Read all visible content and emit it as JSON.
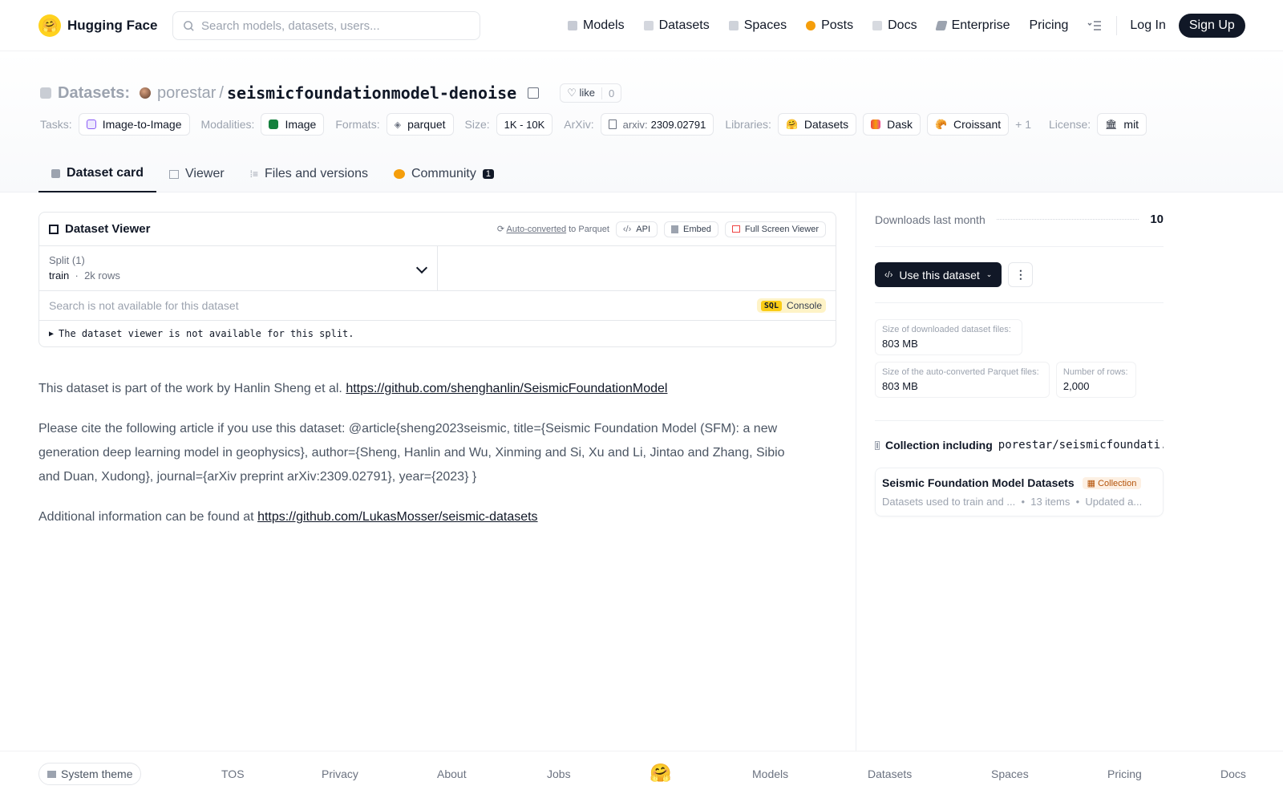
{
  "nav": {
    "brand": "Hugging Face",
    "search_placeholder": "Search models, datasets, users...",
    "links": [
      "Models",
      "Datasets",
      "Spaces",
      "Posts",
      "Docs",
      "Enterprise",
      "Pricing"
    ],
    "login": "Log In",
    "signup": "Sign Up"
  },
  "header": {
    "section": "Datasets:",
    "owner": "porestar",
    "slash": "/",
    "repo": "seismicfoundationmodel-denoise",
    "like_label": "like",
    "like_count": "0",
    "tasks_label": "Tasks:",
    "task": "Image-to-Image",
    "modalities_label": "Modalities:",
    "modality": "Image",
    "formats_label": "Formats:",
    "format": "parquet",
    "size_label": "Size:",
    "size": "1K - 10K",
    "arxiv_label": "ArXiv:",
    "arxiv_prefix": "arxiv:",
    "arxiv_id": "2309.02791",
    "libraries_label": "Libraries:",
    "libraries": [
      "Datasets",
      "Dask",
      "Croissant"
    ],
    "libraries_more": "+ 1",
    "license_label": "License:",
    "license": "mit"
  },
  "tabs": {
    "card": "Dataset card",
    "viewer": "Viewer",
    "files": "Files and versions",
    "community": "Community",
    "community_count": "1"
  },
  "viewer": {
    "title": "Dataset Viewer",
    "auto_converted": "Auto-converted",
    "to_parquet": "to Parquet",
    "api": "API",
    "embed": "Embed",
    "fullscreen": "Full Screen Viewer",
    "split_label": "Split (1)",
    "split_name": "train",
    "split_rows": "2k rows",
    "search_placeholder": "Search is not available for this dataset",
    "sql": "SQL",
    "console": "Console",
    "unavailable": "The dataset viewer is not available for this split."
  },
  "card": {
    "p1_text": "This dataset is part of the work by Hanlin Sheng et al. ",
    "p1_link": "https://github.com/shenghanlin/SeismicFoundationModel",
    "p2_text": "Please cite the following article if you use this dataset: @article{sheng2023seismic, title={Seismic Foundation Model (SFM): a new generation deep learning model in geophysics}, author={Sheng, Hanlin and Wu, Xinming and Si, Xu and Li, Jintao and Zhang, Sibio and Duan, Xudong}, journal={arXiv preprint arXiv:2309.02791}, year={2023} }",
    "p3_text": "Additional information can be found at ",
    "p3_link": "https://github.com/LukasMosser/seismic-datasets"
  },
  "sidebar": {
    "downloads_label": "Downloads last month",
    "downloads_value": "10",
    "use_dataset": "Use this dataset",
    "size_dl_label": "Size of downloaded dataset files:",
    "size_dl_value": "803 MB",
    "size_parquet_label": "Size of the auto-converted Parquet files:",
    "size_parquet_value": "803 MB",
    "rows_label": "Number of rows:",
    "rows_value": "2,000",
    "collection_label": "Collection including",
    "collection_repo": "porestar/seismicfoundati...",
    "collection_title": "Seismic Foundation Model Datasets",
    "collection_badge": "Collection",
    "collection_desc": "Datasets used to train and ...",
    "collection_items": "13 items",
    "collection_updated": "Updated a..."
  },
  "footer": {
    "theme": "System theme",
    "links": [
      "TOS",
      "Privacy",
      "About",
      "Jobs",
      "Models",
      "Datasets",
      "Spaces",
      "Pricing",
      "Docs"
    ]
  }
}
